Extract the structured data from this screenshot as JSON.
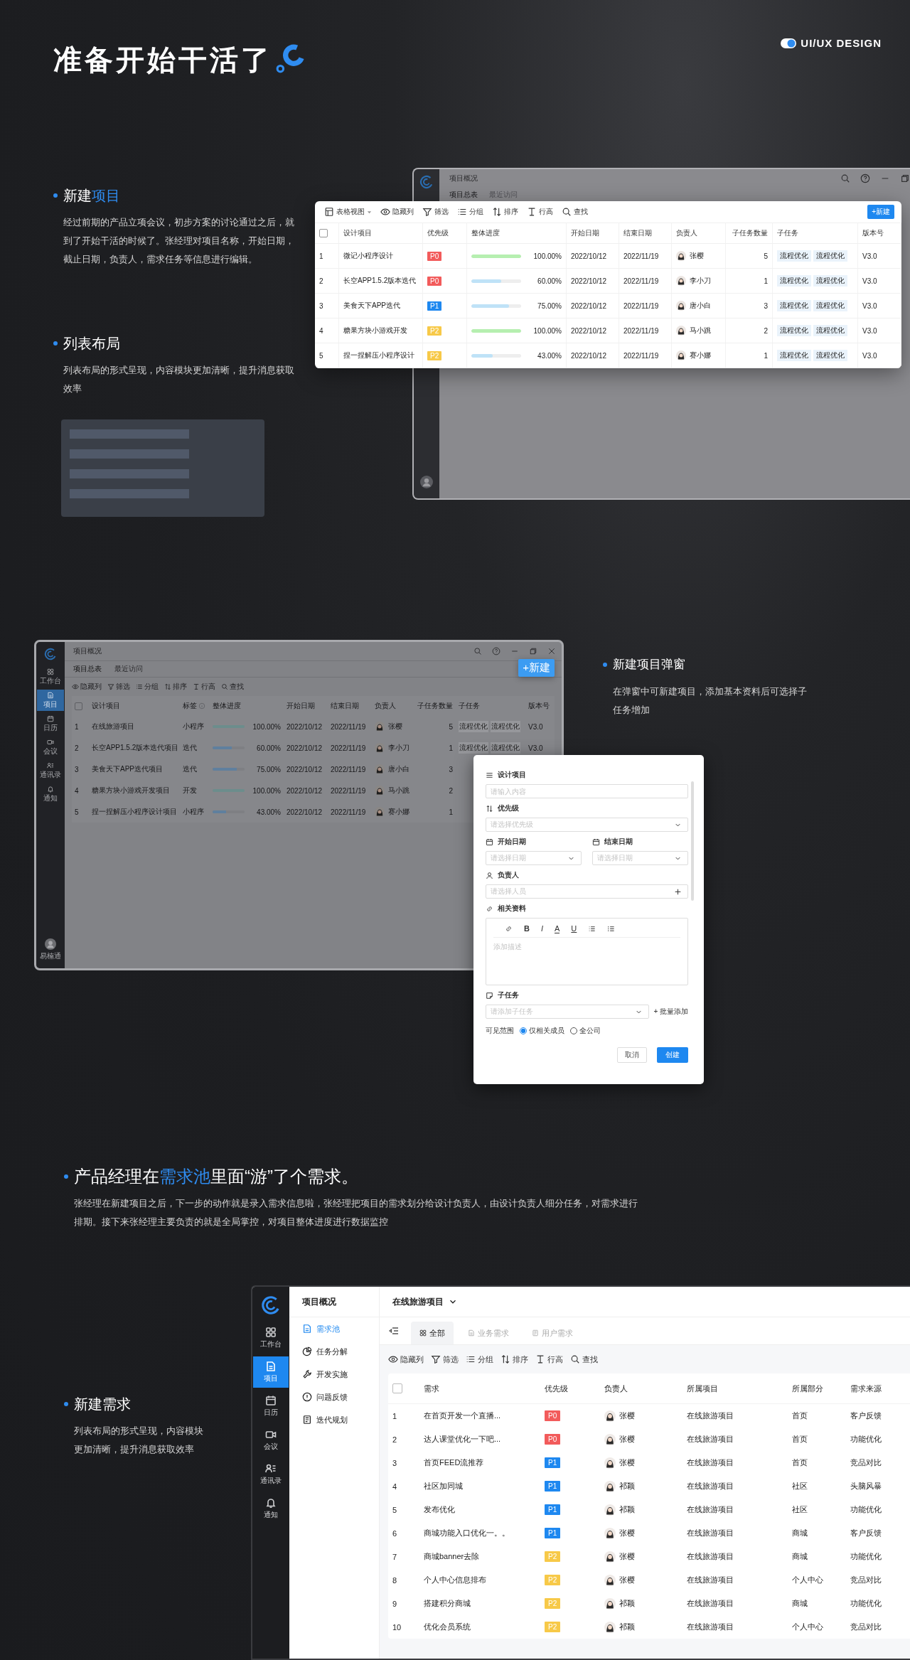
{
  "header": {
    "title": "准备开始干活了",
    "brand": "UI/UX DESIGN"
  },
  "intro": [
    {
      "heading": [
        {
          "text": "新建",
          "highlight": false
        },
        {
          "text": "项目",
          "highlight": true
        }
      ],
      "body": "经过前期的产品立项会议，初步方案的讨论通过之后，就到了开始干活的时候了。张经理对项目名称，开始日期，截止日期，负责人，需求任务等信息进行编辑。"
    },
    {
      "heading": [
        {
          "text": "列表布局",
          "highlight": false
        }
      ],
      "body": "列表布局的形式呈现，内容模块更加清晰，提升消息获取效率"
    }
  ],
  "project_window": {
    "title": "项目概况",
    "tabs": [
      {
        "label": "项目总表",
        "selected": true
      },
      {
        "label": "最近访问",
        "selected": false
      }
    ]
  },
  "project_table": {
    "toolbar": [
      {
        "kind": "view",
        "label": "表格视图",
        "dropdown": true
      },
      {
        "kind": "hide",
        "label": "隐藏列"
      },
      {
        "kind": "filter",
        "label": "筛选"
      },
      {
        "kind": "group",
        "label": "分组"
      },
      {
        "kind": "sort",
        "label": "排序"
      },
      {
        "kind": "height",
        "label": "行高"
      },
      {
        "kind": "search",
        "label": "查找"
      }
    ],
    "new_button": "+新建",
    "select_all": {
      "checked": false
    },
    "columns": [
      "设计项目",
      "优先级",
      "整体进度",
      "开始日期",
      "结束日期",
      "负责人",
      "子任务数量",
      "子任务",
      "版本号"
    ],
    "rows": [
      {
        "index": "1",
        "name": "微记小程序设计",
        "priority": {
          "label": "P0",
          "color": "#f25b5b"
        },
        "level": 1.0,
        "progress": "100.00%",
        "start": "2022/10/12",
        "end": "2022/11/19",
        "owner": "张樱",
        "count": "5",
        "subtasks": [
          "流程优化",
          "流程优化"
        ],
        "version": "V3.0"
      },
      {
        "index": "2",
        "name": "长空APP1.5.2版本迭代",
        "priority": {
          "label": "P0",
          "color": "#f25b5b"
        },
        "level": 0.6,
        "progress": "60.00%",
        "start": "2022/10/12",
        "end": "2022/11/19",
        "owner": "李小刀",
        "count": "1",
        "subtasks": [
          "流程优化",
          "流程优化"
        ],
        "version": "V3.0"
      },
      {
        "index": "3",
        "name": "美食天下APP迭代",
        "priority": {
          "label": "P1",
          "color": "#1e88f0"
        },
        "level": 0.75,
        "progress": "75.00%",
        "start": "2022/10/12",
        "end": "2022/11/19",
        "owner": "唐小白",
        "count": "3",
        "subtasks": [
          "流程优化",
          "流程优化"
        ],
        "version": "V3.0"
      },
      {
        "index": "4",
        "name": "糖果方块小游戏开发",
        "priority": {
          "label": "P2",
          "color": "#f7c948"
        },
        "level": 1.0,
        "progress": "100.00%",
        "start": "2022/10/12",
        "end": "2022/11/19",
        "owner": "马小跳",
        "count": "2",
        "subtasks": [
          "流程优化",
          "流程优化"
        ],
        "version": "V3.0"
      },
      {
        "index": "5",
        "name": "捏一捏解压小程序设计",
        "priority": {
          "label": "P2",
          "color": "#f7c948"
        },
        "level": 0.43,
        "progress": "43.00%",
        "start": "2022/10/12",
        "end": "2022/11/19",
        "owner": "赛小娜",
        "count": "1",
        "subtasks": [
          "流程优化",
          "流程优化"
        ],
        "version": "V3.0"
      }
    ]
  },
  "modal_section": {
    "heading": [
      {
        "text": "新建项目弹窗",
        "highlight": false
      }
    ],
    "body": "在弹窗中可新建项目，添加基本资料后可选择子任务增加"
  },
  "dim_window": {
    "title": "项目概况",
    "sidebar": [
      {
        "kind": "grid",
        "label": "工作台",
        "selected": false
      },
      {
        "kind": "doc",
        "label": "项目",
        "selected": true
      },
      {
        "kind": "calendar",
        "label": "日历",
        "selected": false
      },
      {
        "kind": "video",
        "label": "会议",
        "selected": false
      },
      {
        "kind": "contacts",
        "label": "通讯录",
        "selected": false
      },
      {
        "kind": "bell",
        "label": "通知",
        "selected": false
      }
    ],
    "user": "易楠通",
    "tabs": [
      {
        "label": "项目总表",
        "selected": true
      },
      {
        "label": "最近访问",
        "selected": false
      }
    ],
    "toolbar": [
      {
        "kind": "hide",
        "label": "隐藏列"
      },
      {
        "kind": "filter",
        "label": "筛选"
      },
      {
        "kind": "group",
        "label": "分组"
      },
      {
        "kind": "sort",
        "label": "排序"
      },
      {
        "kind": "height",
        "label": "行高"
      },
      {
        "kind": "search",
        "label": "查找"
      }
    ],
    "new_button": "+新建",
    "select_all": {
      "checked": false
    },
    "columns": [
      "设计项目",
      "标签",
      "整体进度",
      "开始日期",
      "结束日期",
      "负责人",
      "子任务数量",
      "子任务",
      "版本号"
    ],
    "rows": [
      {
        "index": "1",
        "name": "在线旅游项目",
        "tag": "小程序",
        "level": 1.0,
        "progress": "100.00%",
        "start": "2022/10/12",
        "end": "2022/11/19",
        "owner": "张樱",
        "count": "5",
        "subtasks": [
          "流程优化",
          "流程优化"
        ],
        "version": "V3.0"
      },
      {
        "index": "2",
        "name": "长空APP1.5.2版本迭代项目",
        "tag": "迭代",
        "level": 0.6,
        "progress": "60.00%",
        "start": "2022/10/12",
        "end": "2022/11/19",
        "owner": "李小刀",
        "count": "1",
        "subtasks": [
          "流程优化",
          "流程优化"
        ],
        "version": "V3.0"
      },
      {
        "index": "3",
        "name": "美食天下APP迭代项目",
        "tag": "迭代",
        "level": 0.75,
        "progress": "75.00%",
        "start": "2022/10/12",
        "end": "2022/11/19",
        "owner": "唐小白",
        "count": "3"
      },
      {
        "index": "4",
        "name": "糖果方块小游戏开发项目",
        "tag": "开发",
        "level": 1.0,
        "progress": "100.00%",
        "start": "2022/10/12",
        "end": "2022/11/19",
        "owner": "马小跳",
        "count": "2"
      },
      {
        "index": "5",
        "name": "捏一捏解压小程序设计项目",
        "tag": "小程序",
        "level": 0.43,
        "progress": "43.00%",
        "start": "2022/10/12",
        "end": "2022/11/19",
        "owner": "赛小娜",
        "count": "1"
      }
    ]
  },
  "modal": {
    "name": {
      "label": "设计项目",
      "placeholder": "请输入内容"
    },
    "priority": {
      "label": "优先级",
      "placeholder": "请选择优先级"
    },
    "start": {
      "label": "开始日期",
      "placeholder": "请选择日期"
    },
    "end": {
      "label": "结束日期",
      "placeholder": "请选择日期"
    },
    "owner": {
      "label": "负责人",
      "placeholder": "请选择人员"
    },
    "docs": {
      "label": "相关资料",
      "placeholder": "添加描述",
      "tools": [
        {
          "kind": "link"
        },
        {
          "kind": "bold",
          "label": "B"
        },
        {
          "kind": "italic",
          "label": "I"
        },
        {
          "kind": "color",
          "label": "A"
        },
        {
          "kind": "underline",
          "label": "U"
        },
        {
          "kind": "bullets"
        },
        {
          "kind": "numbers"
        }
      ]
    },
    "subtask": {
      "label": "子任务",
      "placeholder": "请添加子任务",
      "batch": "+ 批量添加"
    },
    "scope": {
      "label": "可见范围",
      "options": [
        {
          "label": "仅相关成员",
          "selected": true
        },
        {
          "label": "全公司",
          "selected": false
        }
      ]
    },
    "cancel": "取消",
    "submit": "创建"
  },
  "pool_section": {
    "heading": [
      {
        "text": "产品经理在",
        "highlight": false
      },
      {
        "text": "需求池",
        "highlight": true
      },
      {
        "text": "里面“游”了个需求。",
        "highlight": false
      }
    ],
    "body": "张经理在新建项目之后，下一步的动作就是录入需求信息啦，张经理把项目的需求划分给设计负责人，由设计负责人细分任务，对需求进行排期。接下来张经理主要负责的就是全局掌控，对项目整体进度进行数据监控"
  },
  "list_section": {
    "heading": [
      {
        "text": "新建需求",
        "highlight": false
      }
    ],
    "body": "列表布局的形式呈现，内容模块更加清晰，提升消息获取效率"
  },
  "demand_window": {
    "sidebar": [
      {
        "kind": "grid",
        "label": "工作台",
        "selected": false
      },
      {
        "kind": "doc",
        "label": "项目",
        "selected": true
      },
      {
        "kind": "calendar",
        "label": "日历",
        "selected": false
      },
      {
        "kind": "video",
        "label": "会议",
        "selected": false
      },
      {
        "kind": "contacts",
        "label": "通讯录",
        "selected": false
      },
      {
        "kind": "bell",
        "label": "通知",
        "selected": false
      }
    ],
    "nav_title": "项目概况",
    "nav": [
      {
        "kind": "doc",
        "label": "需求池",
        "selected": true
      },
      {
        "kind": "pie",
        "label": "任务分解",
        "selected": false
      },
      {
        "kind": "wrench",
        "label": "开发实施",
        "selected": false
      },
      {
        "kind": "alert",
        "label": "问题反馈",
        "selected": false
      },
      {
        "kind": "book",
        "label": "迭代规划",
        "selected": false
      }
    ],
    "project": "在线旅游项目",
    "tabs": [
      {
        "kind": "grid",
        "label": "全部",
        "selected": true
      },
      {
        "kind": "doc",
        "label": "业务需求",
        "selected": false
      },
      {
        "kind": "book",
        "label": "用户需求",
        "selected": false
      }
    ],
    "toolbar": [
      {
        "kind": "hide",
        "label": "隐藏列"
      },
      {
        "kind": "filter",
        "label": "筛选"
      },
      {
        "kind": "group",
        "label": "分组"
      },
      {
        "kind": "sort",
        "label": "排序"
      },
      {
        "kind": "height",
        "label": "行高"
      },
      {
        "kind": "search",
        "label": "查找"
      }
    ],
    "select_all": {
      "checked": false
    },
    "columns": [
      "需求",
      "优先级",
      "负责人",
      "所属项目",
      "所属部分",
      "需求来源"
    ],
    "rows": [
      {
        "index": "1",
        "name": "在首页开发一个直播...",
        "priority": {
          "label": "P0",
          "color": "#f25b5b"
        },
        "owner": "张樱",
        "project": "在线旅游项目",
        "part": "首页",
        "source": "客户反馈"
      },
      {
        "index": "2",
        "name": "达人课堂优化一下吧...",
        "priority": {
          "label": "P0",
          "color": "#f25b5b"
        },
        "owner": "张樱",
        "project": "在线旅游项目",
        "part": "首页",
        "source": "功能优化"
      },
      {
        "index": "3",
        "name": "首页FEED流推荐",
        "priority": {
          "label": "P1",
          "color": "#1e88f0"
        },
        "owner": "张樱",
        "project": "在线旅游项目",
        "part": "首页",
        "source": "竞品对比"
      },
      {
        "index": "4",
        "name": "社区加同城",
        "priority": {
          "label": "P1",
          "color": "#1e88f0"
        },
        "owner": "祁颖",
        "project": "在线旅游项目",
        "part": "社区",
        "source": "头脑风暴"
      },
      {
        "index": "5",
        "name": "发布优化",
        "priority": {
          "label": "P1",
          "color": "#1e88f0"
        },
        "owner": "祁颖",
        "project": "在线旅游项目",
        "part": "社区",
        "source": "功能优化"
      },
      {
        "index": "6",
        "name": "商城功能入口优化一。。",
        "priority": {
          "label": "P1",
          "color": "#1e88f0"
        },
        "owner": "张樱",
        "project": "在线旅游项目",
        "part": "商城",
        "source": "客户反馈"
      },
      {
        "index": "7",
        "name": "商城banner去除",
        "priority": {
          "label": "P2",
          "color": "#f7c948"
        },
        "owner": "张樱",
        "project": "在线旅游项目",
        "part": "商城",
        "source": "功能优化"
      },
      {
        "index": "8",
        "name": "个人中心信息排布",
        "priority": {
          "label": "P2",
          "color": "#f7c948"
        },
        "owner": "张樱",
        "project": "在线旅游项目",
        "part": "个人中心",
        "source": "竞品对比"
      },
      {
        "index": "9",
        "name": "搭建积分商城",
        "priority": {
          "label": "P2",
          "color": "#f7c948"
        },
        "owner": "祁颖",
        "project": "在线旅游项目",
        "part": "商城",
        "source": "功能优化"
      },
      {
        "index": "10",
        "name": "优化会员系统",
        "priority": {
          "label": "P2",
          "color": "#f7c948"
        },
        "owner": "祁颖",
        "project": "在线旅游项目",
        "part": "个人中心",
        "source": "竞品对比"
      }
    ]
  }
}
